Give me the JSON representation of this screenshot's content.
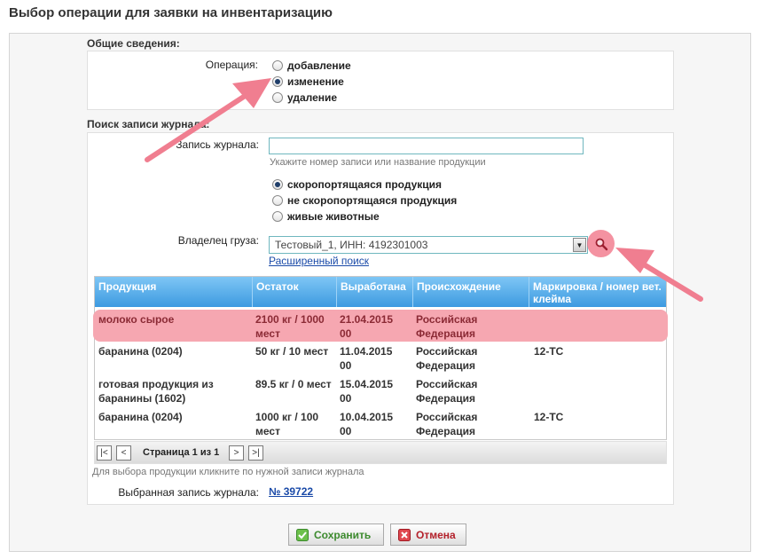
{
  "page": {
    "title": "Выбор операции для заявки на инвентаризацию"
  },
  "general": {
    "section_label": "Общие сведения:",
    "operation_label": "Операция:",
    "operations": [
      {
        "label": "добавление",
        "checked": false
      },
      {
        "label": "изменение",
        "checked": true
      },
      {
        "label": "удаление",
        "checked": false
      }
    ]
  },
  "search": {
    "section_label": "Поиск записи журнала:",
    "record_label": "Запись журнала:",
    "record_value": "",
    "record_hint": "Укажите номер записи или название продукции",
    "product_types": [
      {
        "label": "скоропортящаяся продукция",
        "checked": true
      },
      {
        "label": "не скоропортящаяся продукция",
        "checked": false
      },
      {
        "label": "живые животные",
        "checked": false
      }
    ],
    "owner_label": "Владелец груза:",
    "owner_value": "Тестовый_1, ИНН: 4192301003",
    "advanced_search_link": "Расширенный поиск"
  },
  "grid": {
    "columns": [
      "Продукция",
      "Остаток",
      "Выработана",
      "Происхождение",
      "Маркировка / номер вет. клейма"
    ],
    "rows": [
      {
        "product": "молоко сырое",
        "remainder": "2100 кг / 1000 мест",
        "produced": "21.04.2015 00",
        "origin": "Российская Федерация",
        "marking": "",
        "selected": true
      },
      {
        "product": "баранина (0204)",
        "remainder": "50 кг / 10 мест",
        "produced": "11.04.2015 00",
        "origin": "Российская Федерация",
        "marking": "12-ТС",
        "selected": false
      },
      {
        "product": "готовая продукция из баранины (1602)",
        "remainder": "89.5 кг / 0 мест",
        "produced": "15.04.2015 00",
        "origin": "Российская Федерация",
        "marking": "",
        "selected": false
      },
      {
        "product": "баранина (0204)",
        "remainder": "1000 кг / 100 мест",
        "produced": "10.04.2015 00",
        "origin": "Российская Федерация",
        "marking": "12-ТС",
        "selected": false
      }
    ]
  },
  "pager": {
    "first": "|<",
    "prev": "<",
    "page_text": "Страница 1 из 1",
    "next": ">",
    "last": ">|"
  },
  "grid_hint": "Для выбора продукции кликните по нужной записи журнала",
  "selected_record": {
    "label": "Выбранная запись журнала:",
    "value": "№ 39722"
  },
  "buttons": {
    "save": "Сохранить",
    "cancel": "Отмена"
  },
  "colors": {
    "highlight": "#f6a7b1",
    "header_blue": "#3d9ae0",
    "link": "#1a4aa8",
    "arrow": "#f07e90"
  },
  "icons": {
    "save": "check-icon",
    "cancel": "x-icon",
    "search": "magnifier-icon",
    "dropdown": "triangle-down-icon"
  }
}
